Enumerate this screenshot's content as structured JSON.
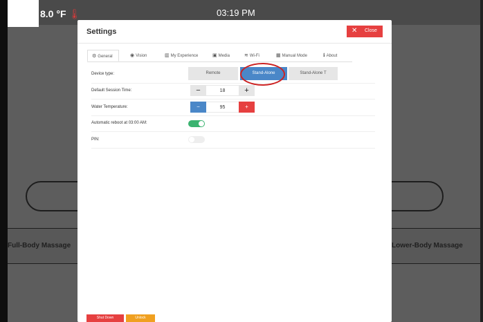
{
  "status_bar": {
    "temperature": "8.0 °F",
    "small_label": "≈ ≡",
    "time": "03:19 PM"
  },
  "background": {
    "left_label": "Full-Body Massage",
    "right_label": "Lower-Body Massage"
  },
  "modal": {
    "title": "Settings",
    "close_label": "Close",
    "tabs": [
      {
        "label": "General",
        "icon": "gear-icon"
      },
      {
        "label": "Vision",
        "icon": "eye-icon"
      },
      {
        "label": "My Experience",
        "icon": "chart-icon"
      },
      {
        "label": "Media",
        "icon": "film-icon"
      },
      {
        "label": "Wi-Fi",
        "icon": "wifi-icon"
      },
      {
        "label": "Manual Mode",
        "icon": "grid-icon"
      },
      {
        "label": "About",
        "icon": "info-icon"
      }
    ],
    "device_type": {
      "label": "Device type:",
      "options": [
        "Remote",
        "Stand-Alone",
        "Stand-Alone T"
      ],
      "selected": "Stand-Alone"
    },
    "session_time": {
      "label": "Default Session Time:",
      "minus": "−",
      "value": "18",
      "plus": "+"
    },
    "water_temp": {
      "label": "Water Temperature:",
      "minus": "−",
      "value": "95",
      "plus": "+"
    },
    "reboot": {
      "label": "Automatic reboot at 03:00 AM:",
      "on": true
    },
    "pin": {
      "label": "PIN:",
      "on": false
    },
    "footer": {
      "left_button": "Shut Down",
      "right_button": "Unlock"
    }
  },
  "colors": {
    "accent": "#4a87c8",
    "danger": "#e64040",
    "success": "#3bb370",
    "warning": "#f0a020"
  }
}
